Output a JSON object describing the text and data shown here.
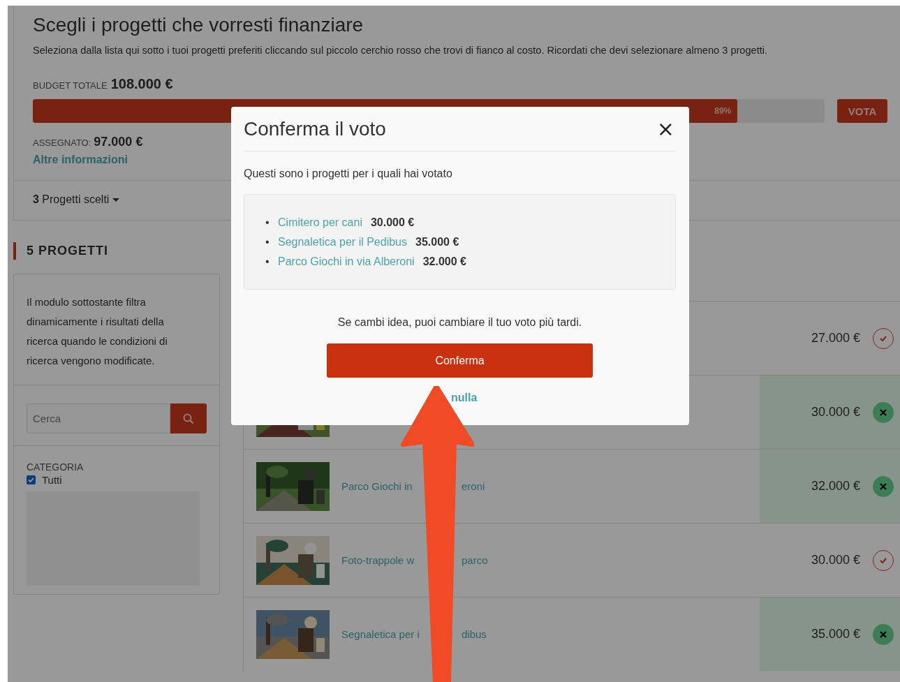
{
  "page": {
    "title": "Scegli i progetti che vorresti finanziare",
    "description": "Seleziona dalla lista qui sotto i tuoi progetti preferiti cliccando sul piccolo cerchio rosso che trovi di fianco al costo. Ricordati che devi selezionare almeno 3 progetti.",
    "budget_label": "BUDGET TOTALE",
    "budget_amount": "108.000 €",
    "progress": {
      "level": 0.89,
      "label": "89%"
    },
    "vote_button": "VOTA",
    "assigned_label": "ASSEGNATO:",
    "assigned_amount": "97.000 €",
    "info_link": "Altre informazioni",
    "chosen": "**3** Progetti scelti"
  },
  "sidebar": {
    "heading": "5 PROGETTI",
    "help_text": "Il modulo sottostante filtra dinamicamente i risultati della ricerca quando le condizioni di ricerca vengono modificate.",
    "search": {
      "placeholder": "Cerca"
    },
    "category_label": "CATEGORIA",
    "categories": [
      {
        "label": "Tutti",
        "checked": true
      }
    ]
  },
  "projects": [
    {
      "price": "27.000 €",
      "selected": false
    },
    {
      "price": "30.000 €",
      "selected": true
    },
    {
      "title_start": "Parco Giochi in",
      "title_end": "eroni",
      "price": "32.000 €",
      "selected": true
    },
    {
      "title_start": "Foto-trappole w",
      "title_end": "parco",
      "price": "30.000 €",
      "selected": false
    },
    {
      "title_start": "Segnaletica per i",
      "title_end": "dibus",
      "price": "35.000 €",
      "selected": true
    }
  ],
  "modal": {
    "title": "Conferma il voto",
    "close": "×",
    "intro": "Questi sono i progetti per i quali hai votato",
    "voted": [
      {
        "marker": "•",
        "name": "Cimitero per cani",
        "amount": "30.000 €"
      },
      {
        "marker": "•",
        "name": "Segnaletica per il Pedibus",
        "amount": "35.000 €"
      },
      {
        "marker": "•",
        "name": "Parco Giochi in via Alberoni",
        "amount": "32.000 €"
      }
    ],
    "note": "Se cambi idea, puoi cambiare il tuo voto più tardi.",
    "confirm_button": "Conferma",
    "cancel_link": "nulla"
  }
}
